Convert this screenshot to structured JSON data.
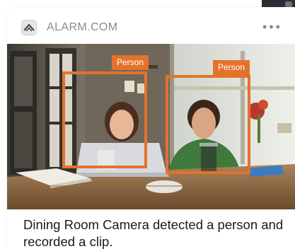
{
  "notification": {
    "app_icon": "alarm-com-logo-icon",
    "app_name": "ALARM.COM",
    "more_icon": "more-horizontal-icon",
    "more_glyph": "•••",
    "message": "Dining Room Camera detected a person and recorded a clip."
  },
  "camera_image": {
    "detections": [
      {
        "label": "Person"
      },
      {
        "label": "Person"
      }
    ]
  },
  "colors": {
    "detection": "#e3732b",
    "app_name": "#8a8a8a",
    "message_text": "#1a1a1a"
  }
}
